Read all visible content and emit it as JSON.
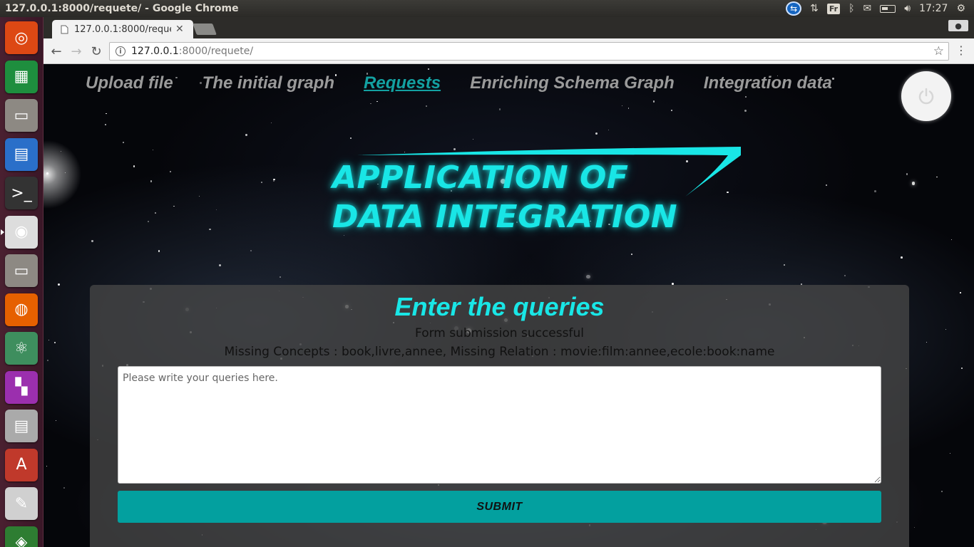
{
  "os": {
    "window_title": "127.0.0.1:8000/requete/ - Google Chrome",
    "keyboard_layout": "Fr",
    "clock": "17:27",
    "launcher": [
      {
        "name": "ubuntu-dash-icon",
        "color": "#dd4814"
      },
      {
        "name": "libreoffice-calc-icon",
        "color": "#1e8e3e"
      },
      {
        "name": "files-icon",
        "color": "#8d8983"
      },
      {
        "name": "libreoffice-writer-icon",
        "color": "#2a6fc9"
      },
      {
        "name": "terminal-icon",
        "color": "#333333"
      },
      {
        "name": "chrome-icon",
        "color": "#dddddd"
      },
      {
        "name": "files-icon-2",
        "color": "#8d8983"
      },
      {
        "name": "firefox-icon",
        "color": "#e66000"
      },
      {
        "name": "atom-icon",
        "color": "#3e8e5e"
      },
      {
        "name": "app-grid-icon",
        "color": "#9b2fae"
      },
      {
        "name": "app-icon-11",
        "color": "#aaaaaa"
      },
      {
        "name": "app-icon-12",
        "color": "#c0392b"
      },
      {
        "name": "app-icon-13",
        "color": "#d0d0d0"
      },
      {
        "name": "app-icon-14",
        "color": "#2e7d32"
      }
    ]
  },
  "browser": {
    "tab_title": "127.0.0.1:8000/requete/",
    "url_host": "127.0.0.1",
    "url_path": ":8000/requete/"
  },
  "nav": {
    "items": [
      {
        "label": "Upload file",
        "active": false
      },
      {
        "label": "The initial graph",
        "active": false
      },
      {
        "label": "Requests",
        "active": true
      },
      {
        "label": "Enriching Schema Graph",
        "active": false
      },
      {
        "label": "Integration data",
        "active": false
      }
    ]
  },
  "logo": {
    "line1": "APPLICATION OF",
    "line2": "DATA INTEGRATION",
    "color": "#19e6e6"
  },
  "form": {
    "title": "Enter the queries",
    "status": "Form submission successful",
    "missing": "Missing Concepts : book,livre,annee, Missing Relation : movie:film:annee,ecole:book:name",
    "placeholder": "Please write your queries here.",
    "submit_label": "SUBMIT",
    "accent": "#03a09f"
  }
}
